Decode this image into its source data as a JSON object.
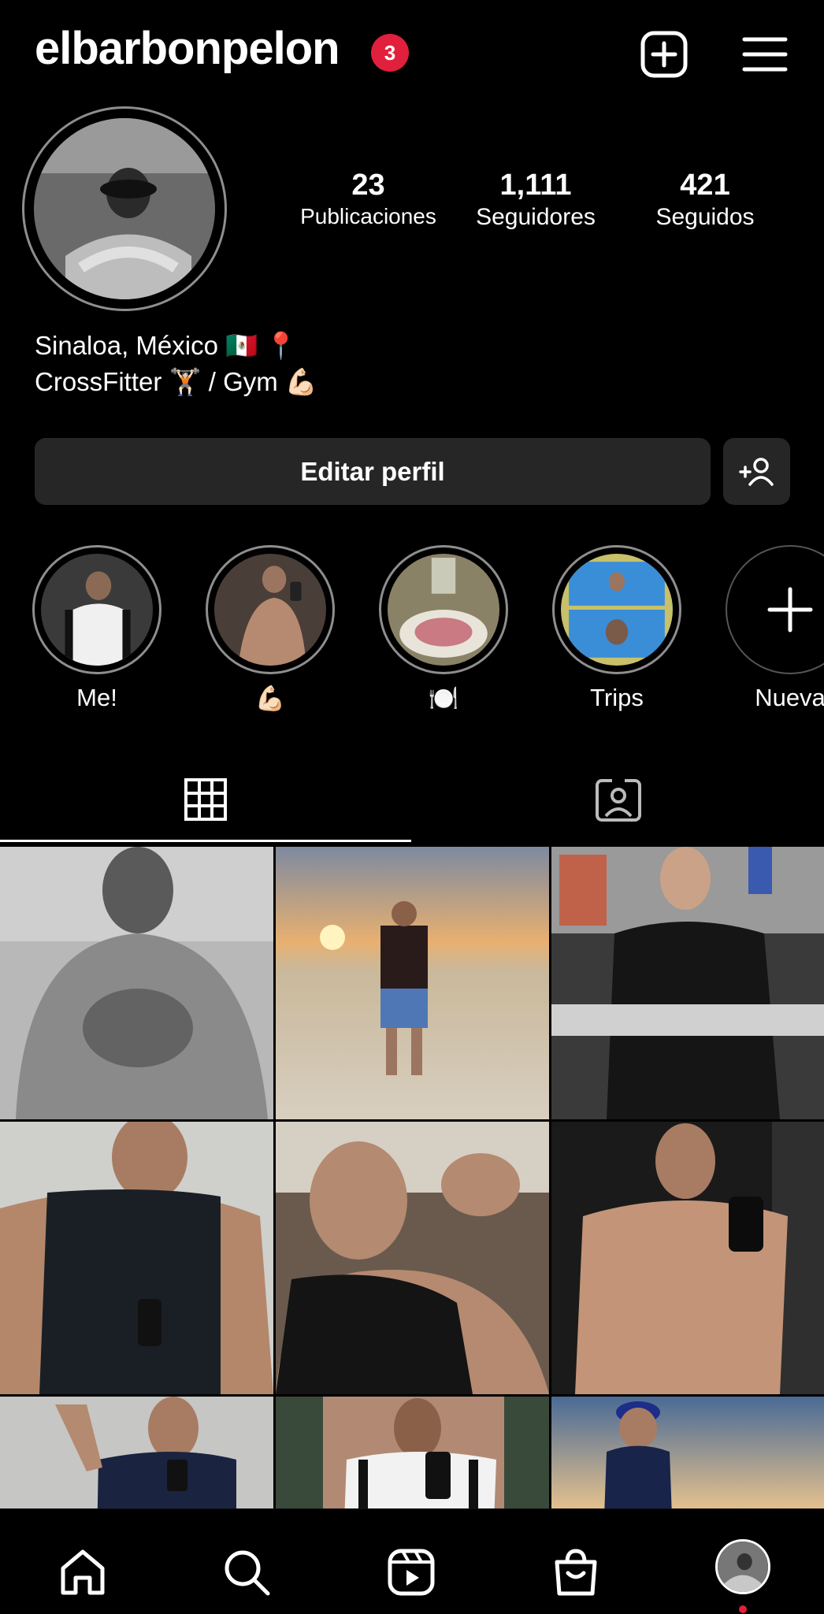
{
  "header": {
    "username": "elbarbonpelon",
    "notification_count": "3",
    "new_post_icon": "plus-square-icon",
    "menu_icon": "hamburger-menu-icon"
  },
  "profile": {
    "stats": [
      {
        "value": "23",
        "label": "Publicaciones"
      },
      {
        "value": "1,111",
        "label": "Seguidores"
      },
      {
        "value": "421",
        "label": "Seguidos"
      }
    ],
    "bio_line1": "Sinaloa, México 🇲🇽 📍",
    "bio_line2": "CrossFitter 🏋🏻 / Gym 💪🏻",
    "edit_label": "Editar perfil",
    "add_person_icon": "add-person-icon"
  },
  "highlights": [
    {
      "label": "Me!"
    },
    {
      "label": "💪🏻"
    },
    {
      "label": "🍽️"
    },
    {
      "label": "Trips"
    },
    {
      "label": "Nueva"
    }
  ],
  "tabs": [
    {
      "icon": "grid-icon",
      "active": true
    },
    {
      "icon": "tagged-icon",
      "active": false
    }
  ],
  "bottom_nav": [
    {
      "icon": "home-icon"
    },
    {
      "icon": "search-icon"
    },
    {
      "icon": "reels-icon"
    },
    {
      "icon": "shop-icon"
    },
    {
      "icon": "profile-avatar-icon"
    }
  ],
  "colors": {
    "background": "#000000",
    "badge": "#e0203c",
    "button_bg": "#262626",
    "ring": "#8e8e8e",
    "nav_dot": "#e0203c"
  }
}
